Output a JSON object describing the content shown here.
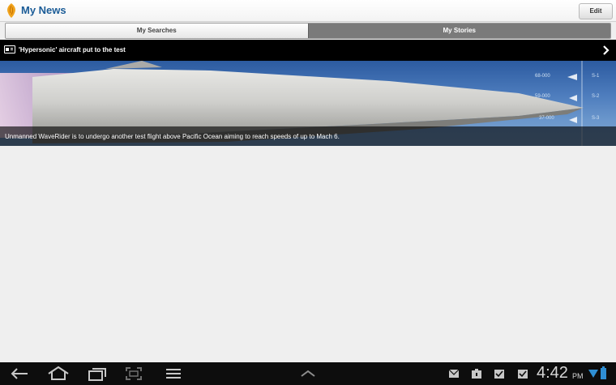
{
  "header": {
    "title": "My News",
    "edit_label": "Edit"
  },
  "tabs": [
    {
      "label": "My Searches",
      "active": false
    },
    {
      "label": "My Stories",
      "active": true
    }
  ],
  "story": {
    "title": "'Hypersonic' aircraft put to the test",
    "caption": "Unmanned WaveRider is to undergo another test flight above Pacific Ocean aiming to reach speeds of up to Mach 6."
  },
  "statusbar": {
    "time": "4:42",
    "ampm": "PM"
  },
  "colors": {
    "brand": "#1b5c97",
    "active_tab": "#7a7a7a",
    "story_bar": "#000000",
    "navbar": "#0d0d0d",
    "battery": "#2f8fd4"
  },
  "icons": [
    "logo-icon",
    "story-icon",
    "chevron-right-icon",
    "back-icon",
    "home-icon",
    "recent-apps-icon",
    "screenshot-icon",
    "menu-icon",
    "up-arrow-icon",
    "mail-icon",
    "notification-icon",
    "checkbox-icon",
    "wifi-icon",
    "battery-icon"
  ]
}
